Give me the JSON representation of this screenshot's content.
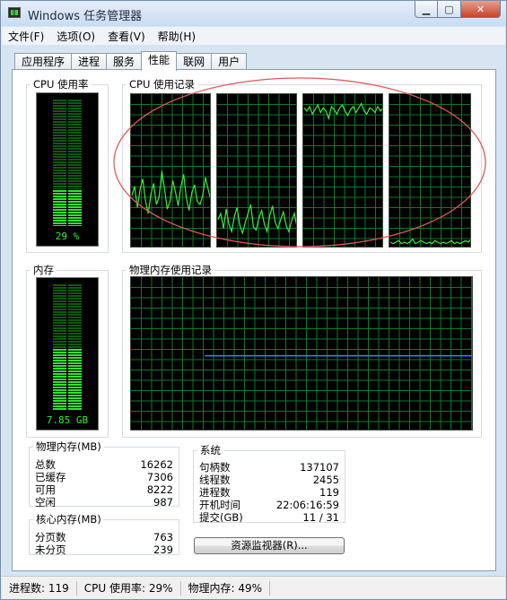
{
  "window": {
    "title": "Windows 任务管理器"
  },
  "menu": [
    "文件(F)",
    "选项(O)",
    "查看(V)",
    "帮助(H)"
  ],
  "tabs": [
    "应用程序",
    "进程",
    "服务",
    "性能",
    "联网",
    "用户"
  ],
  "active_tab": "性能",
  "cpu": {
    "usage_title": "CPU 使用率",
    "usage_text": "29 %",
    "usage_percent": 29,
    "history_title": "CPU 使用记录"
  },
  "memory": {
    "title": "内存",
    "value_text": "7.85 GB",
    "used_percent": 49,
    "history_title": "物理内存使用记录"
  },
  "physical_memory": {
    "title": "物理内存(MB)",
    "rows": [
      {
        "label": "总数",
        "value": "16262"
      },
      {
        "label": "已缓存",
        "value": "7306"
      },
      {
        "label": "可用",
        "value": "8222"
      },
      {
        "label": "空闲",
        "value": "987"
      }
    ]
  },
  "kernel_memory": {
    "title": "核心内存(MB)",
    "rows": [
      {
        "label": "分页数",
        "value": "763"
      },
      {
        "label": "未分页",
        "value": "239"
      }
    ]
  },
  "system": {
    "title": "系统",
    "rows": [
      {
        "label": "句柄数",
        "value": "137107"
      },
      {
        "label": "线程数",
        "value": "2455"
      },
      {
        "label": "进程数",
        "value": "119"
      },
      {
        "label": "开机时间",
        "value": "22:06:16:59"
      },
      {
        "label": "提交(GB)",
        "value": "11 / 31"
      }
    ]
  },
  "resource_monitor_button": "资源监视器(R)...",
  "status": {
    "processes": "进程数: 119",
    "cpu": "CPU 使用率: 29%",
    "memory": "物理内存: 49%"
  },
  "colors": {
    "graph_grid": "#0b7a2c",
    "cpu_line": "#3bee3b",
    "memory_line": "#3a74ff",
    "annotation_ellipse": "#e05a5a"
  },
  "cpu_history": [
    [
      34,
      40,
      26,
      38,
      45,
      30,
      22,
      35,
      42,
      28,
      33,
      50,
      38,
      25,
      30,
      44,
      36,
      27,
      40,
      48,
      32,
      24,
      36,
      41,
      30,
      28,
      34,
      46,
      38,
      31
    ],
    [
      18,
      22,
      12,
      25,
      15,
      10,
      20,
      26,
      14,
      9,
      16,
      22,
      28,
      13,
      11,
      19,
      24,
      15,
      10,
      21,
      27,
      16,
      12,
      18,
      23,
      14,
      10,
      17,
      22,
      13
    ],
    [
      92,
      90,
      93,
      88,
      91,
      94,
      89,
      92,
      90,
      85,
      93,
      91,
      88,
      92,
      94,
      90,
      87,
      91,
      93,
      89,
      92,
      95,
      90,
      88,
      92,
      91,
      89,
      93,
      90,
      92
    ],
    [
      3,
      2,
      3,
      4,
      2,
      3,
      2,
      3,
      5,
      2,
      3,
      4,
      3,
      2,
      3,
      2,
      4,
      3,
      2,
      3,
      2,
      3,
      4,
      2,
      3,
      2,
      3,
      4,
      3,
      5
    ]
  ],
  "memory_history_percent": 49
}
